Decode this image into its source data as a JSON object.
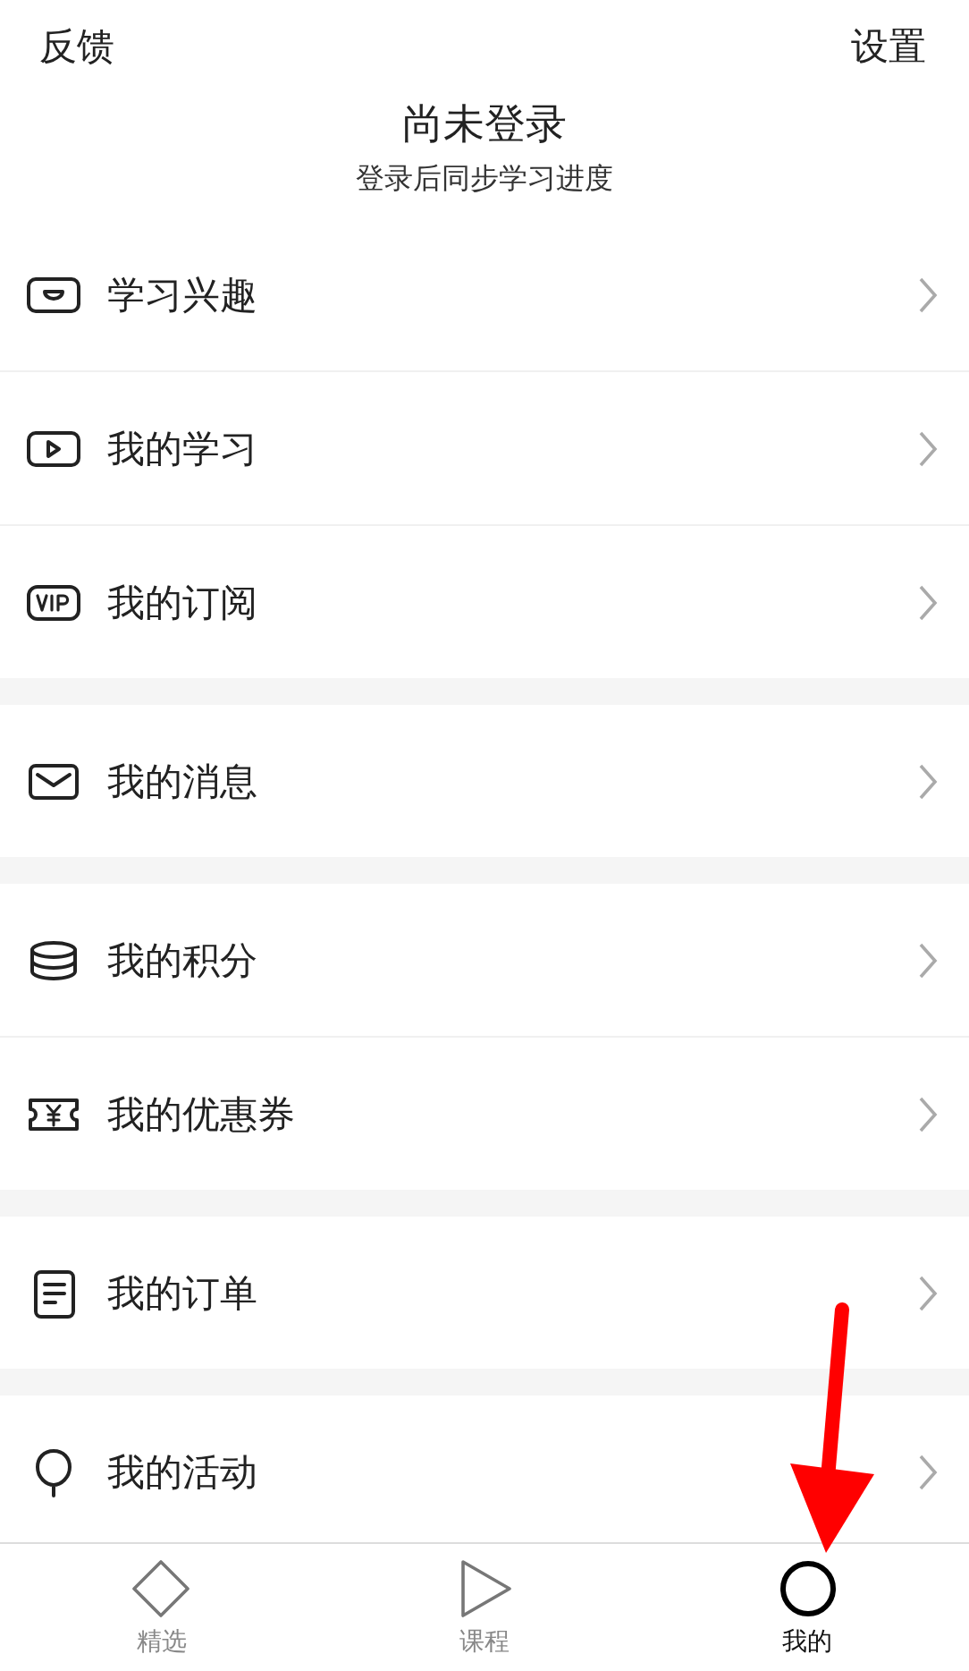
{
  "header": {
    "left_link": "反馈",
    "right_link": "设置",
    "title": "尚未登录",
    "subtitle": "登录后同步学习进度"
  },
  "groups": [
    {
      "items": [
        {
          "kind": "interest",
          "label": "学习兴趣"
        },
        {
          "kind": "play",
          "label": "我的学习"
        },
        {
          "kind": "vip",
          "label": "我的订阅"
        }
      ]
    },
    {
      "items": [
        {
          "kind": "mail",
          "label": "我的消息"
        }
      ]
    },
    {
      "items": [
        {
          "kind": "coins",
          "label": "我的积分"
        },
        {
          "kind": "coupon",
          "label": "我的优惠券"
        }
      ]
    },
    {
      "items": [
        {
          "kind": "order",
          "label": "我的订单"
        }
      ]
    },
    {
      "items": [
        {
          "kind": "balloon",
          "label": "我的活动"
        }
      ]
    }
  ],
  "tabs": [
    {
      "kind": "diamond",
      "label": "精选",
      "selected": false
    },
    {
      "kind": "play",
      "label": "课程",
      "selected": false
    },
    {
      "kind": "circle",
      "label": "我的",
      "selected": true
    }
  ],
  "annotation": {
    "kind": "arrow"
  }
}
